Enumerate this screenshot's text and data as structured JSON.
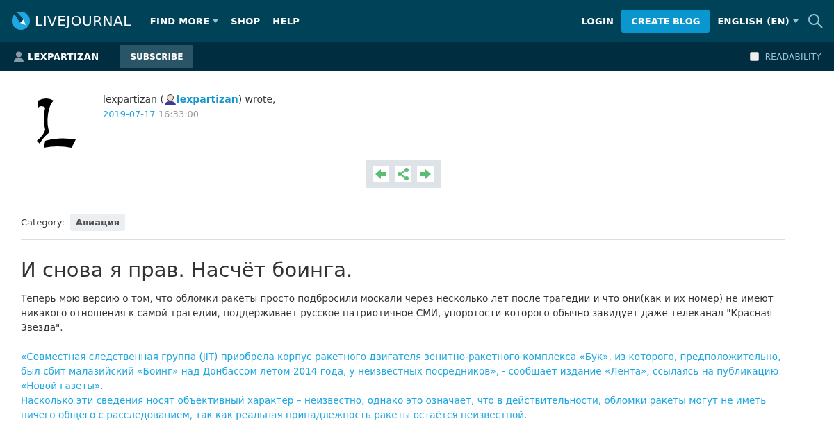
{
  "header": {
    "logo": "LIVEJOURNAL",
    "nav": [
      {
        "label": "FIND MORE",
        "dropdown": true
      },
      {
        "label": "SHOP",
        "dropdown": false
      },
      {
        "label": "HELP",
        "dropdown": false
      }
    ],
    "login": "LOGIN",
    "create": "CREATE BLOG",
    "language": "ENGLISH (EN)"
  },
  "subbar": {
    "user": "LEXPARTIZAN",
    "subscribe": "SUBSCRIBE",
    "readability": {
      "label": "READABILITY",
      "checked": false
    }
  },
  "post": {
    "author": "lexpartizan (",
    "user_link": "lexpartizan",
    "wrote": ") wrote,",
    "date": "2019-07-17",
    "time": "16:33:00",
    "category_label": "Category:",
    "category": "Авиация",
    "title": "И снова я прав. Насчёт боинга.",
    "paragraphs": [
      {
        "kind": "text",
        "text": "Теперь мою версию о том, что обломки ракеты просто подбросили москали через несколько лет после трагедии и что они(как и их номер) не имеют никакого отношения к самой трагедии, поддерживает русское патриотичное СМИ, упоротости которого обычно завидует даже телеканал \"Красная Звезда\"."
      },
      {
        "kind": "link",
        "text": "«Совместная следственная группа (JIT) приобрела корпус ракетного двигателя зенитно-ракетного комплекса «Бук», из которого, предположительно, был сбит малазийский «Боинг» над Донбассом летом 2014 года, у неизвестных посредников», - сообщает издание «Лента», ссылаясь на публикацию «Новой газеты»."
      },
      {
        "kind": "link",
        "text": "Насколько эти сведения носят объективный характер – неизвестно, однако это означает, что в действительности, обломки ракеты могут не иметь ничего общего с расследованием, так как реальная принадлежность ракеты остаётся неизвестной."
      }
    ]
  }
}
